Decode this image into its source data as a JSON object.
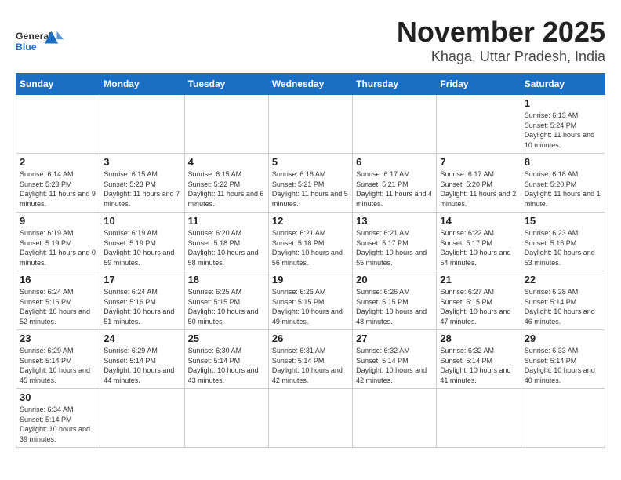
{
  "header": {
    "title": "November 2025",
    "subtitle": "Khaga, Uttar Pradesh, India",
    "logo_general": "General",
    "logo_blue": "Blue"
  },
  "weekdays": [
    "Sunday",
    "Monday",
    "Tuesday",
    "Wednesday",
    "Thursday",
    "Friday",
    "Saturday"
  ],
  "weeks": [
    [
      {
        "day": "",
        "info": ""
      },
      {
        "day": "",
        "info": ""
      },
      {
        "day": "",
        "info": ""
      },
      {
        "day": "",
        "info": ""
      },
      {
        "day": "",
        "info": ""
      },
      {
        "day": "",
        "info": ""
      },
      {
        "day": "1",
        "info": "Sunrise: 6:13 AM\nSunset: 5:24 PM\nDaylight: 11 hours\nand 10 minutes."
      }
    ],
    [
      {
        "day": "2",
        "info": "Sunrise: 6:14 AM\nSunset: 5:23 PM\nDaylight: 11 hours\nand 9 minutes."
      },
      {
        "day": "3",
        "info": "Sunrise: 6:15 AM\nSunset: 5:23 PM\nDaylight: 11 hours\nand 7 minutes."
      },
      {
        "day": "4",
        "info": "Sunrise: 6:15 AM\nSunset: 5:22 PM\nDaylight: 11 hours\nand 6 minutes."
      },
      {
        "day": "5",
        "info": "Sunrise: 6:16 AM\nSunset: 5:21 PM\nDaylight: 11 hours\nand 5 minutes."
      },
      {
        "day": "6",
        "info": "Sunrise: 6:17 AM\nSunset: 5:21 PM\nDaylight: 11 hours\nand 4 minutes."
      },
      {
        "day": "7",
        "info": "Sunrise: 6:17 AM\nSunset: 5:20 PM\nDaylight: 11 hours\nand 2 minutes."
      },
      {
        "day": "8",
        "info": "Sunrise: 6:18 AM\nSunset: 5:20 PM\nDaylight: 11 hours\nand 1 minute."
      }
    ],
    [
      {
        "day": "9",
        "info": "Sunrise: 6:19 AM\nSunset: 5:19 PM\nDaylight: 11 hours\nand 0 minutes."
      },
      {
        "day": "10",
        "info": "Sunrise: 6:19 AM\nSunset: 5:19 PM\nDaylight: 10 hours\nand 59 minutes."
      },
      {
        "day": "11",
        "info": "Sunrise: 6:20 AM\nSunset: 5:18 PM\nDaylight: 10 hours\nand 58 minutes."
      },
      {
        "day": "12",
        "info": "Sunrise: 6:21 AM\nSunset: 5:18 PM\nDaylight: 10 hours\nand 56 minutes."
      },
      {
        "day": "13",
        "info": "Sunrise: 6:21 AM\nSunset: 5:17 PM\nDaylight: 10 hours\nand 55 minutes."
      },
      {
        "day": "14",
        "info": "Sunrise: 6:22 AM\nSunset: 5:17 PM\nDaylight: 10 hours\nand 54 minutes."
      },
      {
        "day": "15",
        "info": "Sunrise: 6:23 AM\nSunset: 5:16 PM\nDaylight: 10 hours\nand 53 minutes."
      }
    ],
    [
      {
        "day": "16",
        "info": "Sunrise: 6:24 AM\nSunset: 5:16 PM\nDaylight: 10 hours\nand 52 minutes."
      },
      {
        "day": "17",
        "info": "Sunrise: 6:24 AM\nSunset: 5:16 PM\nDaylight: 10 hours\nand 51 minutes."
      },
      {
        "day": "18",
        "info": "Sunrise: 6:25 AM\nSunset: 5:15 PM\nDaylight: 10 hours\nand 50 minutes."
      },
      {
        "day": "19",
        "info": "Sunrise: 6:26 AM\nSunset: 5:15 PM\nDaylight: 10 hours\nand 49 minutes."
      },
      {
        "day": "20",
        "info": "Sunrise: 6:26 AM\nSunset: 5:15 PM\nDaylight: 10 hours\nand 48 minutes."
      },
      {
        "day": "21",
        "info": "Sunrise: 6:27 AM\nSunset: 5:15 PM\nDaylight: 10 hours\nand 47 minutes."
      },
      {
        "day": "22",
        "info": "Sunrise: 6:28 AM\nSunset: 5:14 PM\nDaylight: 10 hours\nand 46 minutes."
      }
    ],
    [
      {
        "day": "23",
        "info": "Sunrise: 6:29 AM\nSunset: 5:14 PM\nDaylight: 10 hours\nand 45 minutes."
      },
      {
        "day": "24",
        "info": "Sunrise: 6:29 AM\nSunset: 5:14 PM\nDaylight: 10 hours\nand 44 minutes."
      },
      {
        "day": "25",
        "info": "Sunrise: 6:30 AM\nSunset: 5:14 PM\nDaylight: 10 hours\nand 43 minutes."
      },
      {
        "day": "26",
        "info": "Sunrise: 6:31 AM\nSunset: 5:14 PM\nDaylight: 10 hours\nand 42 minutes."
      },
      {
        "day": "27",
        "info": "Sunrise: 6:32 AM\nSunset: 5:14 PM\nDaylight: 10 hours\nand 42 minutes."
      },
      {
        "day": "28",
        "info": "Sunrise: 6:32 AM\nSunset: 5:14 PM\nDaylight: 10 hours\nand 41 minutes."
      },
      {
        "day": "29",
        "info": "Sunrise: 6:33 AM\nSunset: 5:14 PM\nDaylight: 10 hours\nand 40 minutes."
      }
    ],
    [
      {
        "day": "30",
        "info": "Sunrise: 6:34 AM\nSunset: 5:14 PM\nDaylight: 10 hours\nand 39 minutes."
      },
      {
        "day": "",
        "info": ""
      },
      {
        "day": "",
        "info": ""
      },
      {
        "day": "",
        "info": ""
      },
      {
        "day": "",
        "info": ""
      },
      {
        "day": "",
        "info": ""
      },
      {
        "day": "",
        "info": ""
      }
    ]
  ]
}
